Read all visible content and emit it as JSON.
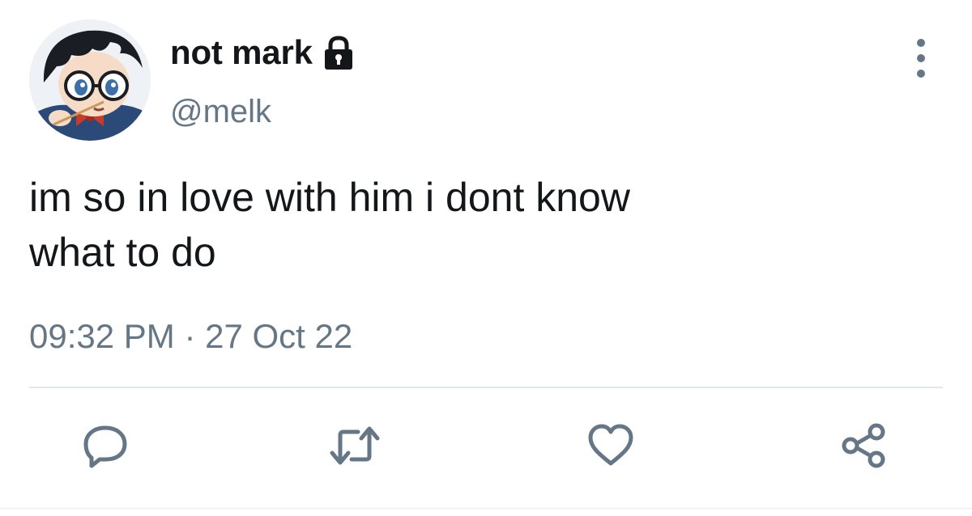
{
  "user": {
    "display_name": "not mark",
    "handle": "@melk",
    "protected_icon": "lock-icon",
    "avatar_icon": "anime-character-avatar"
  },
  "tweet": {
    "text": "im so in love with him i dont know\nwhat to do",
    "time": "09:32 PM",
    "separator": "·",
    "date": "27 Oct 22"
  },
  "actions": [
    {
      "icon": "reply-icon"
    },
    {
      "icon": "retweet-icon"
    },
    {
      "icon": "like-icon"
    },
    {
      "icon": "share-icon"
    }
  ],
  "menu_icon": "more-vertical-icon",
  "colors": {
    "text_primary": "#14171a",
    "text_secondary": "#657786",
    "divider": "#e1e8ed"
  }
}
